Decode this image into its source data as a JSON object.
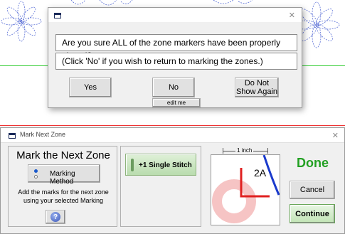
{
  "confirm_dialog": {
    "message": "Are you sure ALL of the zone markers have been properly placed?",
    "note": "(Click 'No' if you wish to return to marking the zones.)",
    "yes_label": "Yes",
    "no_label": "No",
    "do_not_show_line1": "Do Not",
    "do_not_show_line2": "Show Again",
    "edit_label": "edit me",
    "close_icon": "close-icon"
  },
  "panel": {
    "title": "Mark Next Zone",
    "heading": "Mark the Next Zone",
    "marking_method_label": "Marking Method",
    "instruction_line1": "Add the marks for the next zone",
    "instruction_line2": "using your selected Marking",
    "help_glyph": "?",
    "stitch_label": "+1  Single Stitch",
    "ruler_label": "1 inch",
    "zone_label": "2A",
    "done_label": "Done",
    "cancel_label": "Cancel",
    "continue_label": "Continue",
    "close_icon": "close-icon"
  },
  "colors": {
    "done_green": "#22a022",
    "zone_red": "#e02020",
    "guide_blue": "#1a3acc",
    "ring_pink": "#f6c4c4",
    "design_blue": "#5a6fd6"
  }
}
